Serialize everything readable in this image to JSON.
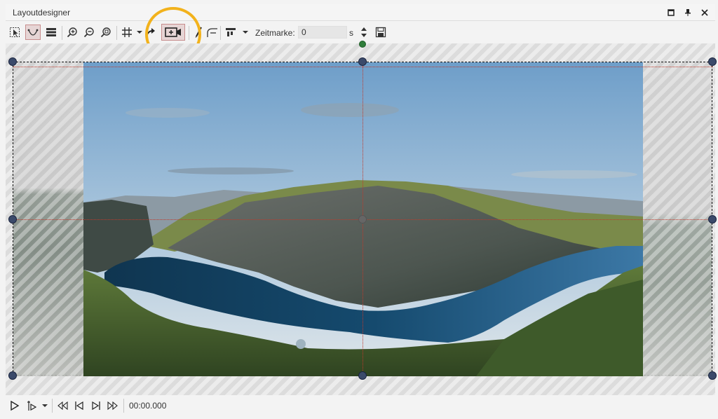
{
  "window": {
    "title": "Layoutdesigner"
  },
  "toolbar": {
    "zeitmarke_label": "Zeitmarke:",
    "zeitmarke_value": "0",
    "zeitmarke_unit": "s"
  },
  "playback": {
    "time": "00:00.000"
  },
  "colors": {
    "highlight": "#f2b21c",
    "handle": "#3b4a6a",
    "guide": "#c0392b",
    "rotation_handle": "#2f7d3a"
  }
}
